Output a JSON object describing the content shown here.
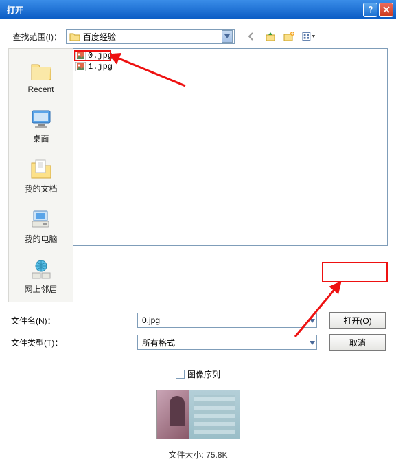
{
  "titlebar": {
    "title": "打开"
  },
  "lookIn": {
    "label": "查找范围(I)：",
    "value": "百度经验"
  },
  "places": [
    {
      "label": "Recent"
    },
    {
      "label": "桌面"
    },
    {
      "label": "我的文档"
    },
    {
      "label": "我的电脑"
    },
    {
      "label": "网上邻居"
    }
  ],
  "files": [
    {
      "name": "0.jpg"
    },
    {
      "name": "1.jpg"
    }
  ],
  "fileNameRow": {
    "label": "文件名(N)：",
    "value": "0.jpg"
  },
  "fileTypeRow": {
    "label": "文件类型(T)：",
    "value": "所有格式"
  },
  "buttons": {
    "open": "打开(O)",
    "cancel": "取消"
  },
  "imageSequence": {
    "label": "图像序列"
  },
  "fileSize": {
    "label": "文件大小: 75.8K"
  },
  "icons": {
    "help": "help-icon",
    "close": "close-icon",
    "back": "back-arrow-icon",
    "up": "up-one-level-icon",
    "newFolder": "new-folder-icon",
    "viewMenu": "view-menu-icon"
  }
}
